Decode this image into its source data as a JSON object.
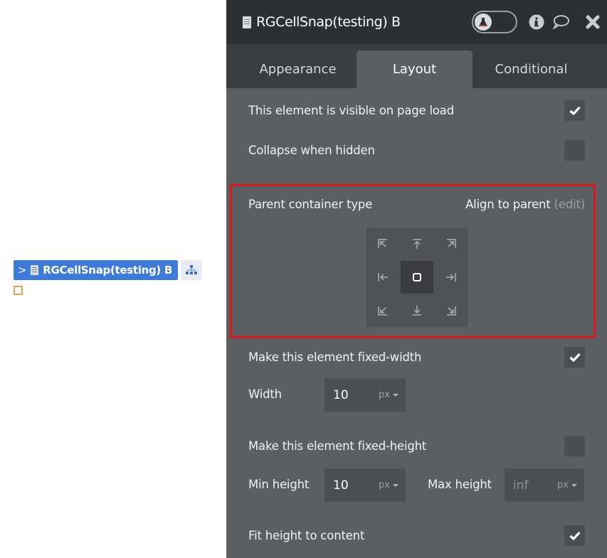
{
  "canvas": {
    "element_label": "RGCellSnap(testing) B",
    "expand_icon": "chevron-right-icon",
    "doc_icon": "document-icon",
    "tree_button_icon": "hierarchy-icon"
  },
  "panel": {
    "title": "RGCellSnap(testing) B",
    "header_icons": [
      "flask-toggle-icon",
      "info-icon",
      "comment-icon",
      "close-icon"
    ],
    "tabs": [
      {
        "label": "Appearance",
        "active": false
      },
      {
        "label": "Layout",
        "active": true
      },
      {
        "label": "Conditional",
        "active": false
      }
    ],
    "visible_on_load": {
      "label": "This element is visible on page load",
      "checked": true
    },
    "collapse_hidden": {
      "label": "Collapse when hidden",
      "checked": false
    },
    "parent_container": {
      "label": "Parent container type",
      "value": "Align to parent",
      "edit_label": "(edit)",
      "alignment_selected": "center"
    },
    "fixed_width": {
      "label": "Make this element fixed-width",
      "checked": true
    },
    "width": {
      "label": "Width",
      "value": "10",
      "unit": "px"
    },
    "fixed_height": {
      "label": "Make this element fixed-height",
      "checked": false
    },
    "min_height": {
      "label": "Min height",
      "value": "10",
      "unit": "px"
    },
    "max_height": {
      "label": "Max height",
      "placeholder": "inf",
      "unit": "px"
    },
    "fit_height": {
      "label": "Fit height to content",
      "checked": true
    }
  },
  "colors": {
    "accent_blue": "#3d7ad9",
    "highlight_red": "#e0141a",
    "panel_bg": "#5b5f63",
    "header_bg": "#2d3033"
  }
}
